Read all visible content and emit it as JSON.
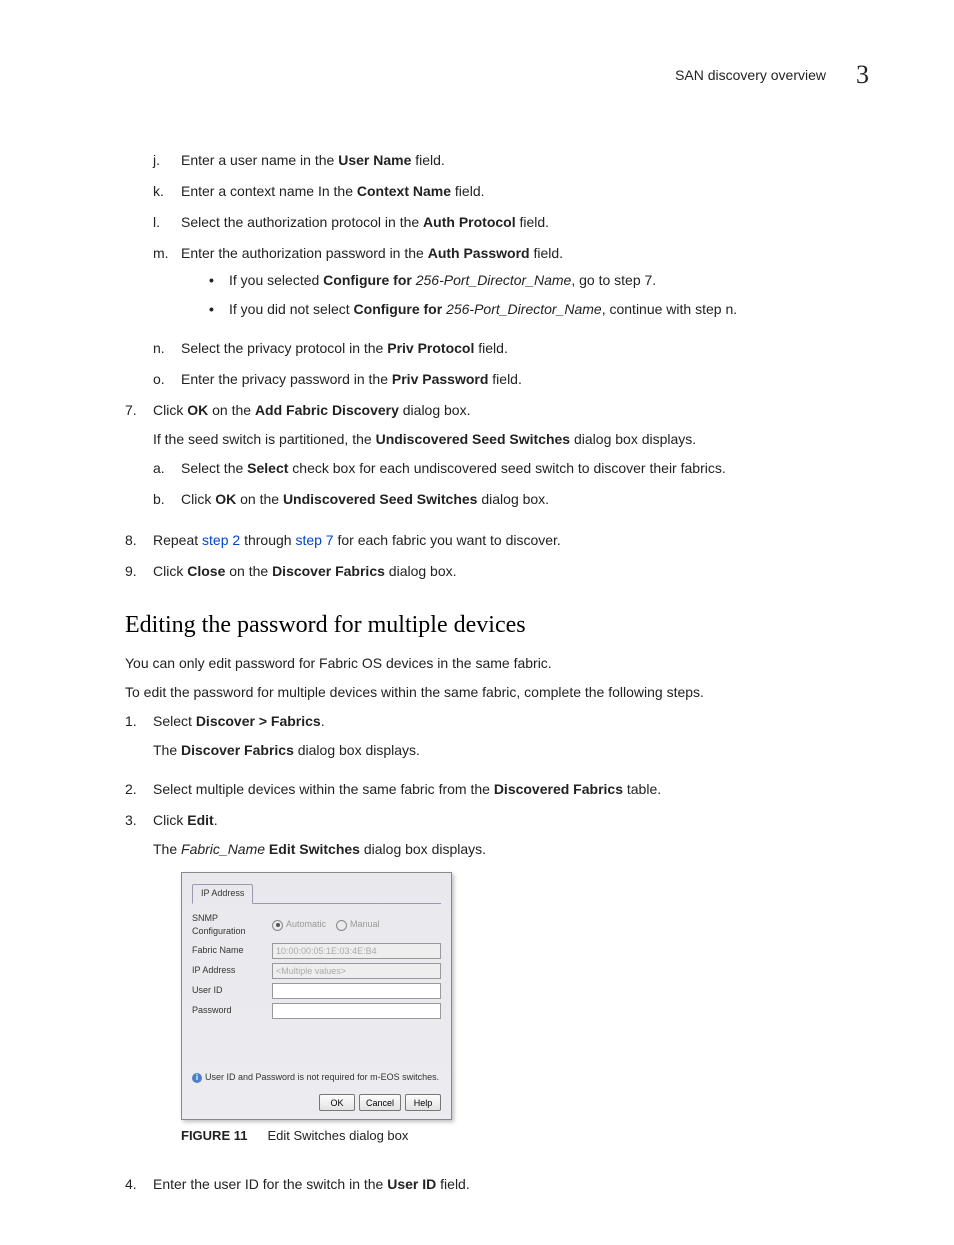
{
  "header": {
    "running_title": "SAN discovery overview",
    "chapter_number": "3"
  },
  "sub_items": {
    "j": {
      "m": "j.",
      "pre": "Enter a user name in the ",
      "bold": "User Name",
      "post": " field."
    },
    "k": {
      "m": "k.",
      "pre": "Enter a context name In the ",
      "bold": "Context Name",
      "post": " field."
    },
    "l": {
      "m": "l.",
      "pre": "Select the authorization protocol in the ",
      "bold": "Auth Protocol",
      "post": " field."
    },
    "m": {
      "m": "m.",
      "pre": "Enter the authorization password in the ",
      "bold": "Auth Password",
      "post": " field."
    },
    "m_b1": {
      "pre": "If you selected ",
      "bold": "Configure for",
      "em": " 256-Port_Director_Name",
      "post": ", go to step 7."
    },
    "m_b2": {
      "pre": "If you did not select ",
      "bold": "Configure for",
      "em": " 256-Port_Director_Name",
      "post": ", continue with step n."
    },
    "n": {
      "m": "n.",
      "pre": "Select the privacy protocol in the ",
      "bold": "Priv Protocol",
      "post": " field."
    },
    "o": {
      "m": "o.",
      "pre": "Enter the privacy password in the ",
      "bold": "Priv Password",
      "post": " field."
    }
  },
  "step7": {
    "m": "7.",
    "line1": {
      "pre": "Click ",
      "b1": "OK",
      "mid": " on the ",
      "b2": "Add Fabric Discovery",
      "post": " dialog box."
    },
    "line2": {
      "pre": "If the seed switch is partitioned, the ",
      "b": "Undiscovered Seed Switches",
      "post": " dialog box displays."
    },
    "a": {
      "m": "a.",
      "pre": "Select the ",
      "b": "Select",
      "post": " check box for each undiscovered seed switch to discover their fabrics."
    },
    "b": {
      "m": "b.",
      "pre": "Click ",
      "b1": "OK",
      "mid": " on the ",
      "b2": "Undiscovered Seed Switches",
      "post": " dialog box."
    }
  },
  "step8": {
    "m": "8.",
    "pre": "Repeat ",
    "link1": "step 2",
    "mid": " through ",
    "link2": "step 7",
    "post": " for each fabric you want to discover."
  },
  "step9": {
    "m": "9.",
    "pre": "Click ",
    "b1": "Close",
    "mid": " on the ",
    "b2": "Discover Fabrics",
    "post": " dialog box."
  },
  "section": {
    "heading": "Editing the password for multiple devices",
    "p1": "You can only edit password for Fabric OS devices in the same fabric.",
    "p2": "To edit the password for multiple devices within the same fabric, complete the following steps."
  },
  "edit_steps": {
    "s1": {
      "m": "1.",
      "pre": "Select ",
      "b": "Discover > Fabrics",
      "post": "."
    },
    "s1_p": {
      "pre": "The ",
      "b": "Discover Fabrics",
      "post": " dialog box displays."
    },
    "s2": {
      "m": "2.",
      "pre": "Select multiple devices within the same fabric from the ",
      "b": "Discovered Fabrics",
      "post": " table."
    },
    "s3": {
      "m": "3.",
      "pre": "Click ",
      "b": "Edit",
      "post": "."
    },
    "s3_p": {
      "pre": "The ",
      "em": "Fabric_Name",
      "b": " Edit Switches",
      "post": " dialog box displays."
    },
    "s4": {
      "m": "4.",
      "pre": "Enter the user ID for the switch in the ",
      "b": "User ID",
      "post": " field."
    }
  },
  "dialog": {
    "tab": "IP Address",
    "rows": {
      "snmp": "SNMP Configuration",
      "auto": "Automatic",
      "manual": "Manual",
      "fabric": "Fabric Name",
      "fabric_val": "10:00:00:05:1E:03:4E:B4",
      "ip": "IP Address",
      "ip_val": "<Multiple values>",
      "user": "User ID",
      "pass": "Password"
    },
    "note": "User ID and Password is not required for m-EOS switches.",
    "buttons": {
      "ok": "OK",
      "cancel": "Cancel",
      "help": "Help"
    }
  },
  "figure": {
    "label": "FIGURE 11",
    "caption": "Edit Switches dialog box"
  }
}
